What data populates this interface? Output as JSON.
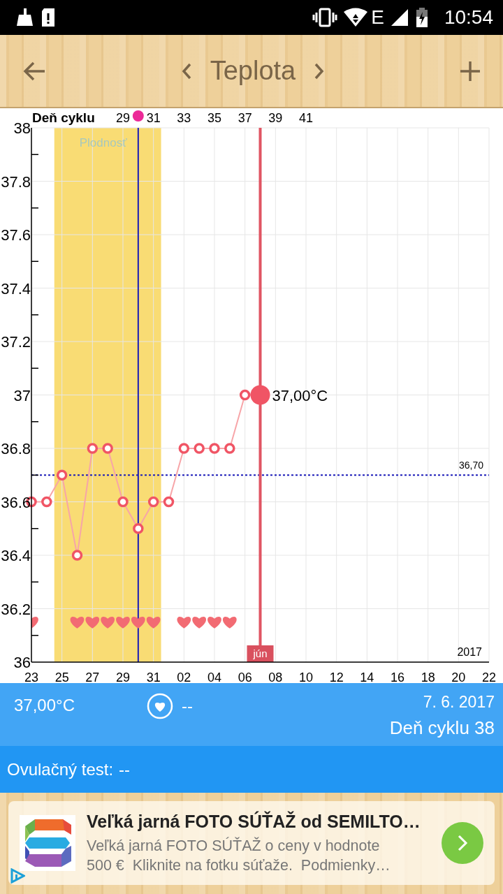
{
  "status_bar": {
    "network": "E",
    "time": "10:54"
  },
  "toolbar": {
    "title": "Teplota"
  },
  "chart": {
    "chart_data": {
      "type": "line",
      "grid": true,
      "xlabel": "Deň cyklu",
      "x": [
        23,
        24,
        25,
        26,
        27,
        28,
        29,
        30,
        31,
        32,
        33,
        34,
        35,
        36,
        37,
        38
      ],
      "series": [
        {
          "color": "#f05565",
          "marker": "circle",
          "values": [
            36.6,
            36.6,
            36.7,
            36.4,
            36.8,
            36.8,
            36.6,
            36.5,
            36.6,
            36.6,
            36.8,
            36.8,
            36.8,
            36.8,
            37.0,
            37.0
          ]
        },
        {
          "type": "scatter",
          "color": "#f26b73",
          "values": [
            36.15,
            null,
            null,
            36.15,
            36.15,
            36.15,
            36.15,
            36.15,
            36.15,
            null,
            36.15,
            36.15,
            36.15,
            36.15,
            null,
            null
          ]
        }
      ],
      "xlim": [
        23,
        53
      ],
      "ylim": [
        36,
        38
      ],
      "xticks": [
        29,
        31,
        33,
        35,
        37,
        39,
        41
      ],
      "yticks": [
        {
          "value": 38,
          "label": "38"
        },
        {
          "value": 37.8,
          "label": "37.8"
        },
        {
          "value": 37.6,
          "label": "37.6"
        },
        {
          "value": 37.4,
          "label": "37.4"
        },
        {
          "value": 37.2,
          "label": "37.2"
        },
        {
          "value": 37,
          "label": "37"
        },
        {
          "value": 36.8,
          "label": "36.8"
        },
        {
          "value": 36.6,
          "label": "36.6"
        },
        {
          "value": 36.4,
          "label": "36.4"
        },
        {
          "value": 36.2,
          "label": "36.2"
        },
        {
          "value": 36,
          "label": "36"
        }
      ],
      "bands": [
        {
          "axis": "x",
          "from": 24.5,
          "to": 31.5,
          "label": "Plodnosť",
          "color": "#f9dc74"
        }
      ],
      "ref_lines": [
        {
          "axis": "y",
          "value": 36.7,
          "label": "36,70",
          "color": "#1a1ab8"
        },
        {
          "axis": "x",
          "value": 30,
          "color": "#1a1ab8"
        },
        {
          "axis": "x",
          "value": 38,
          "label": "jún",
          "color": "#e05563"
        }
      ],
      "annotations": [
        {
          "x": 38,
          "y": 37,
          "text": "37,00°C"
        }
      ]
    },
    "date_axis": [
      "23",
      "25",
      "27",
      "29",
      "31",
      "02",
      "04",
      "06",
      "08",
      "10",
      "12",
      "14",
      "16",
      "18",
      "20",
      "22"
    ],
    "year": "2017"
  },
  "summary": {
    "temperature": "37,00°C",
    "intercourse": "--",
    "date": "7. 6. 2017",
    "cycle_day": "Deň cyklu 38"
  },
  "ovulation_test": {
    "label": "Ovulačný test:",
    "value": "--"
  },
  "ad": {
    "title": "Veľká jarná FOTO SÚŤAŽ od SEMILTO…",
    "text_lines": [
      "Veľká jarná FOTO SÚŤAŽ o ceny v hodnote",
      "500 €  Kliknite na fotku súťaže.  Podmienky…"
    ]
  }
}
